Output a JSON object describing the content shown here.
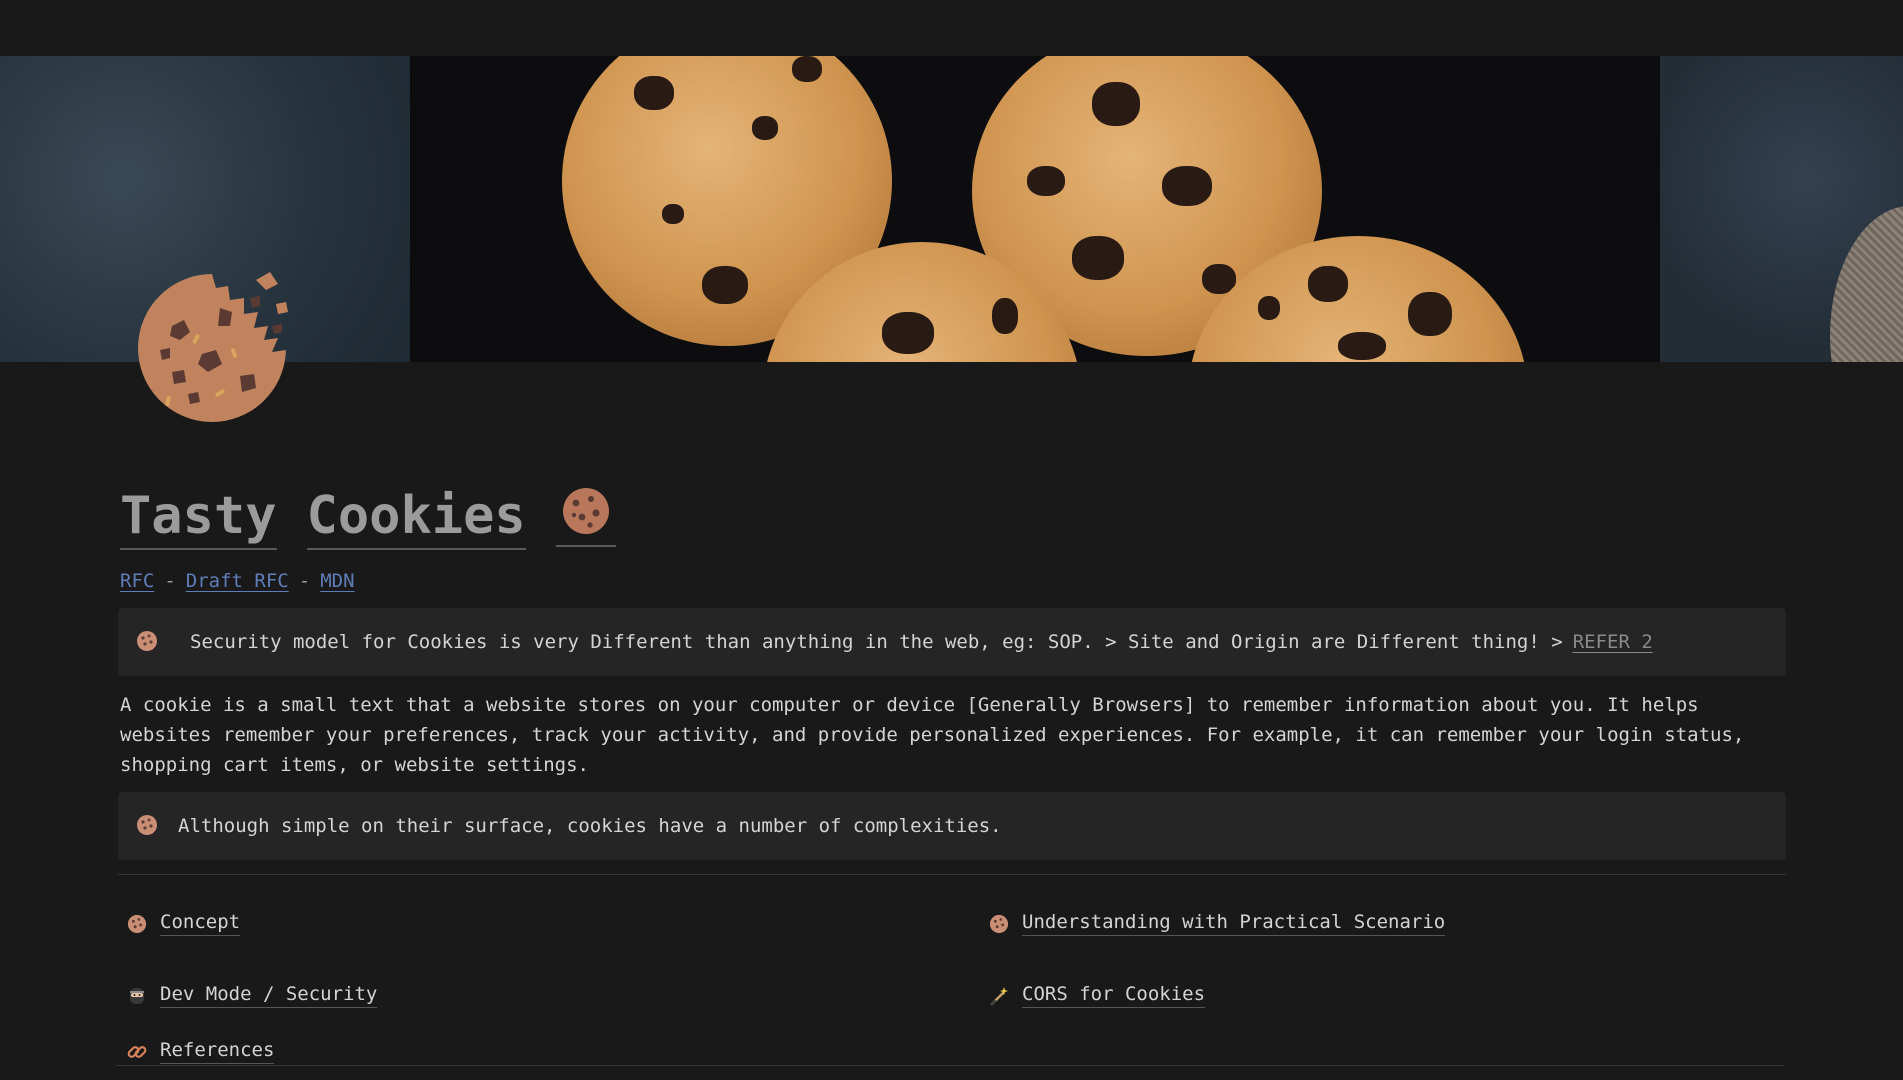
{
  "page": {
    "title_word1": "Tasty",
    "title_word2": "Cookies",
    "title_emoji_icon": "cookie-icon",
    "page_icon": "bitten-cookie-icon"
  },
  "links": [
    {
      "label": "RFC"
    },
    {
      "label": "Draft RFC"
    },
    {
      "label": "MDN"
    }
  ],
  "separator": "-",
  "callout_security": {
    "icon": "cookie-icon",
    "text": "Security model for Cookies is very Different than anything in the web, eg: SOP. > Site and Origin are Different thing! >",
    "link_label": "REFER",
    "link_number": "2"
  },
  "paragraph": "A cookie is a small text that a website stores on your computer or device [Generally Browsers] to remember information about you. It helps websites remember your preferences, track your activity, and provide personalized experiences. For example, it can remember your login status, shopping cart items, or website settings.",
  "callout_complexity": {
    "icon": "cookie-icon",
    "text": "Although simple on their surface, cookies have a number of complexities."
  },
  "nav": {
    "concept": {
      "icon": "cookie-icon",
      "label": "Concept"
    },
    "practical": {
      "icon": "cookie-icon",
      "label": "Understanding with Practical Scenario"
    },
    "devmode": {
      "icon": "ninja-icon",
      "label": "Dev Mode / Security"
    },
    "cors": {
      "icon": "magic-wand-icon",
      "label": "CORS for Cookies"
    },
    "references": {
      "icon": "link-icon",
      "label": "References"
    }
  },
  "colors": {
    "background": "#191919",
    "link": "#5f7db8",
    "callout_bg": "#252525",
    "title": "#9b9b9b"
  }
}
